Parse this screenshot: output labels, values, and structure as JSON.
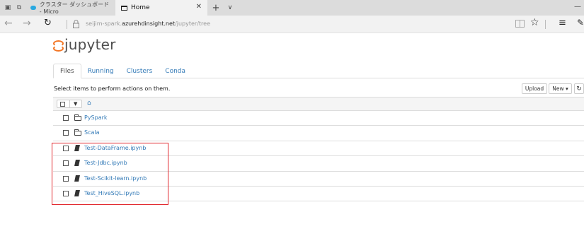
{
  "browser": {
    "tabs": [
      {
        "label": "クラスター ダッシュボード - Micro",
        "active": false
      },
      {
        "label": "Home",
        "active": true
      }
    ],
    "close_glyph": "✕",
    "new_tab_glyph": "+",
    "tab_list_glyph": "∨",
    "url_prefix": "seijim-spark.",
    "url_host": "azurehdinsight.net",
    "url_path": "/jupyter/tree"
  },
  "jupyter": {
    "logo_text": "jupyter",
    "tabs": [
      "Files",
      "Running",
      "Clusters",
      "Conda"
    ],
    "active_tab": "Files",
    "instructions": "Select items to perform actions on them.",
    "buttons": {
      "upload": "Upload",
      "new": "New ▾",
      "refresh": "↻"
    },
    "items": [
      {
        "name": "PySpark",
        "type": "folder"
      },
      {
        "name": "Scala",
        "type": "folder"
      },
      {
        "name": "Test-DataFrame.ipynb",
        "type": "notebook"
      },
      {
        "name": "Test-Jdbc.ipynb",
        "type": "notebook"
      },
      {
        "name": "Test-Scikit-learn.ipynb",
        "type": "notebook"
      },
      {
        "name": "Test_HiveSQL.ipynb",
        "type": "notebook"
      }
    ]
  },
  "colors": {
    "accent_link": "#337ab7",
    "highlight_box": "#e2292f",
    "logo_orange": "#f37726"
  }
}
